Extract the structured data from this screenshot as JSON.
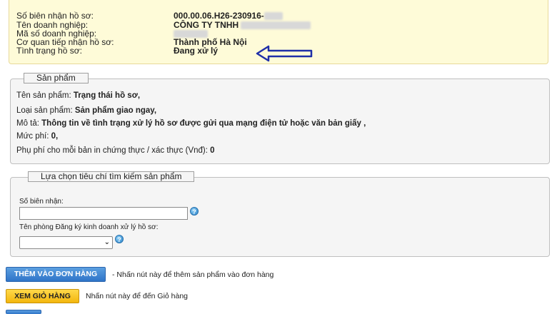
{
  "info": {
    "rows": [
      {
        "label": "Số biên nhận hồ sơ:",
        "value": "000.00.06.H26-230916-"
      },
      {
        "label": "Tên doanh nghiệp:",
        "value": "CÔNG TY TNHH"
      },
      {
        "label": "Mã số doanh nghiệp:",
        "value": ""
      },
      {
        "label": "Cơ quan tiếp nhận hồ sơ:",
        "value": "Thành phố Hà Nội"
      },
      {
        "label": "Tình trạng hồ sơ:",
        "value": "Đang xử lý"
      }
    ]
  },
  "product": {
    "legend": "Sản phẩm",
    "name_label": "Tên sản phẩm: ",
    "name_value": "Trạng thái hồ sơ,",
    "type_label": "Loại sản phẩm: ",
    "type_value": "Sản phẩm giao ngay,",
    "desc_label": "Mô tả: ",
    "desc_value": "Thông tin về tình trạng xử lý hồ sơ được gửi qua mạng điện tử hoặc văn bản giấy ,",
    "fee_label": "Mức phí: ",
    "fee_value": "0,",
    "extra_label": "Phụ phí cho mỗi bản in chứng thực / xác thực (Vnđ): ",
    "extra_value": "0"
  },
  "search": {
    "legend": "Lựa chọn tiêu chí tìm kiếm sản phẩm",
    "receipt_label": "Số biên nhận:",
    "receipt_value": "",
    "office_label": "Tên phòng Đăng ký kinh doanh xử lý hồ sơ:",
    "office_selected": ""
  },
  "actions": {
    "add_button": "THÊM VÀO ĐƠN HÀNG",
    "add_note": "- Nhấn nút này để thêm sản phẩm vào đơn hàng",
    "cart_button": "XEM GIỎ HÀNG",
    "cart_note": "Nhấn nút này để đến Giỏ hàng"
  },
  "colors": {
    "info_bg": "#fefbd8",
    "arrow": "#1f2fa8",
    "button_blue": "#3a7fd0",
    "button_yellow": "#f6c325"
  }
}
